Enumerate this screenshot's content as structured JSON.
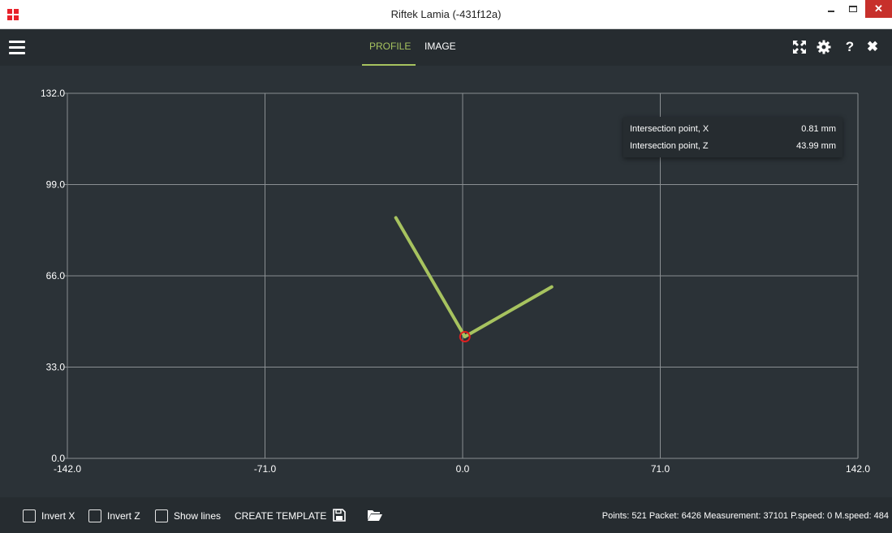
{
  "window": {
    "title": "Riftek Lamia (-431f12a)"
  },
  "tabs": [
    {
      "label": "PROFILE",
      "active": true
    },
    {
      "label": "IMAGE",
      "active": false
    }
  ],
  "toolbar_icons": [
    "menu-icon",
    "fullscreen-icon",
    "gear-icon",
    "help-icon",
    "close-icon"
  ],
  "accent_color": "#a7c35f",
  "chart_data": {
    "type": "line",
    "x_ticks": [
      "-142.0",
      "-71.0",
      "0.0",
      "71.0",
      "142.0"
    ],
    "y_ticks": [
      "0.0",
      "33.0",
      "66.0",
      "99.0",
      "132.0"
    ],
    "xlim": [
      -142,
      142
    ],
    "ylim": [
      0,
      132
    ],
    "grid": true,
    "series": [
      {
        "x": [
          -24,
          0.8
        ],
        "y": [
          87,
          44
        ]
      },
      {
        "x": [
          0.8,
          32
        ],
        "y": [
          44,
          62
        ]
      }
    ],
    "marker": {
      "x": 0.81,
      "z": 43.99,
      "color": "#e01e1e"
    },
    "line_color": "#a7c35f"
  },
  "tooltip": {
    "rows": [
      {
        "label": "Intersection point, X",
        "value": "0.81 mm"
      },
      {
        "label": "Intersection point, Z",
        "value": "43.99 mm"
      }
    ]
  },
  "bottom": {
    "invert_x": "Invert X",
    "invert_z": "Invert Z",
    "show_lines": "Show lines",
    "create_template": "CREATE TEMPLATE",
    "status": "Points: 521  Packet: 6426  Measurement: 37101  P.speed: 0  M.speed: 484"
  }
}
